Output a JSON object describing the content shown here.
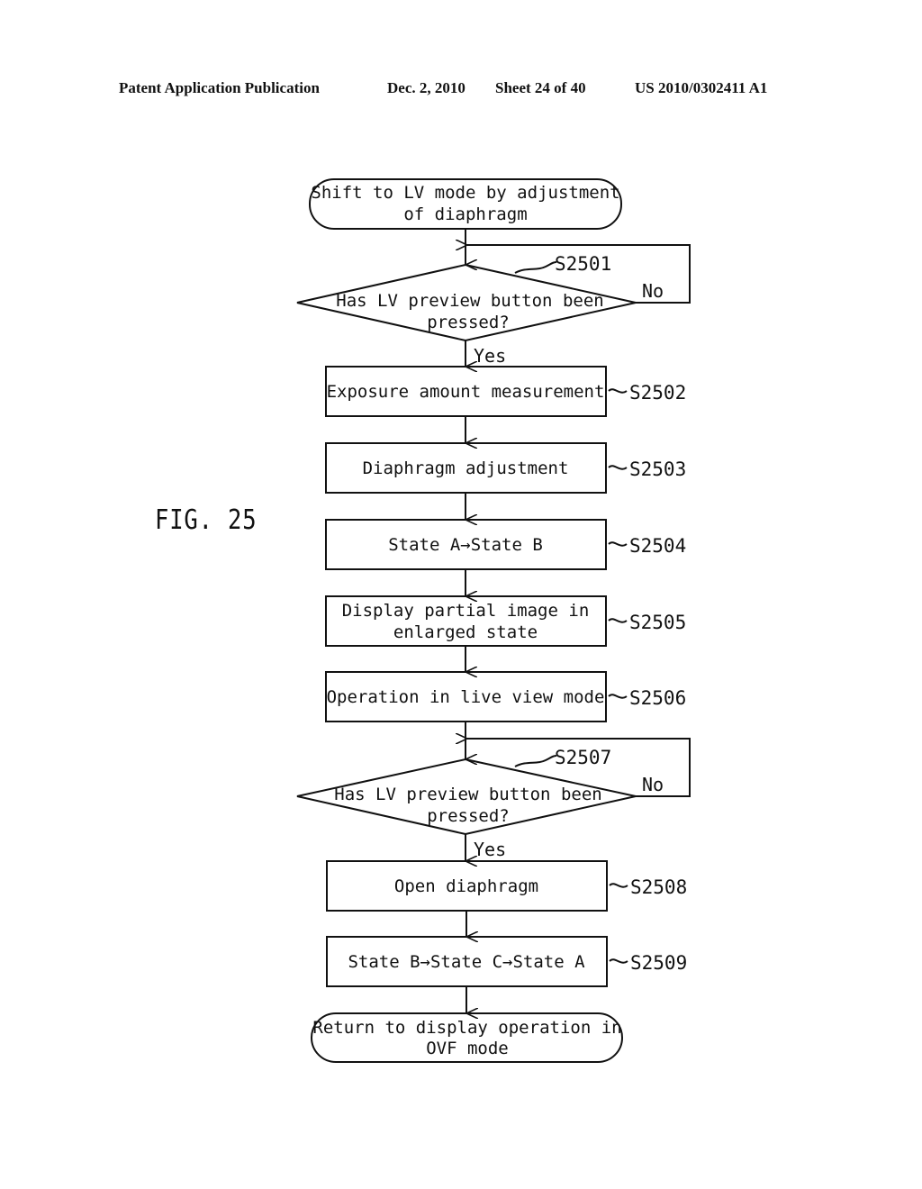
{
  "header": {
    "publication": "Patent Application Publication",
    "date": "Dec. 2, 2010",
    "sheet": "Sheet 24 of 40",
    "number": "US 2010/0302411 A1"
  },
  "figure": {
    "label": "FIG. 25"
  },
  "flowchart": {
    "start": {
      "lines": [
        "Shift to LV mode by adjustment",
        "of diaphragm"
      ]
    },
    "decision1": {
      "step": "S2501",
      "lines": [
        "Has LV preview button been",
        "pressed?"
      ],
      "yes_label": "Yes",
      "no_label": "No"
    },
    "steps": [
      {
        "step": "S2502",
        "lines": [
          "Exposure amount measurement"
        ]
      },
      {
        "step": "S2503",
        "lines": [
          "Diaphragm adjustment"
        ]
      },
      {
        "step": "S2504",
        "lines": [
          "State A→State B"
        ]
      },
      {
        "step": "S2505",
        "lines": [
          "Display partial image in",
          "enlarged state"
        ]
      },
      {
        "step": "S2506",
        "lines": [
          "Operation in live view mode"
        ]
      }
    ],
    "decision2": {
      "step": "S2507",
      "lines": [
        "Has LV preview button been",
        "pressed?"
      ],
      "yes_label": "Yes",
      "no_label": "No"
    },
    "steps2": [
      {
        "step": "S2508",
        "lines": [
          "Open diaphragm"
        ]
      },
      {
        "step": "S2509",
        "lines": [
          "State B→State C→State A"
        ]
      }
    ],
    "end": {
      "lines": [
        "Return to display operation in",
        "OVF mode"
      ]
    }
  }
}
